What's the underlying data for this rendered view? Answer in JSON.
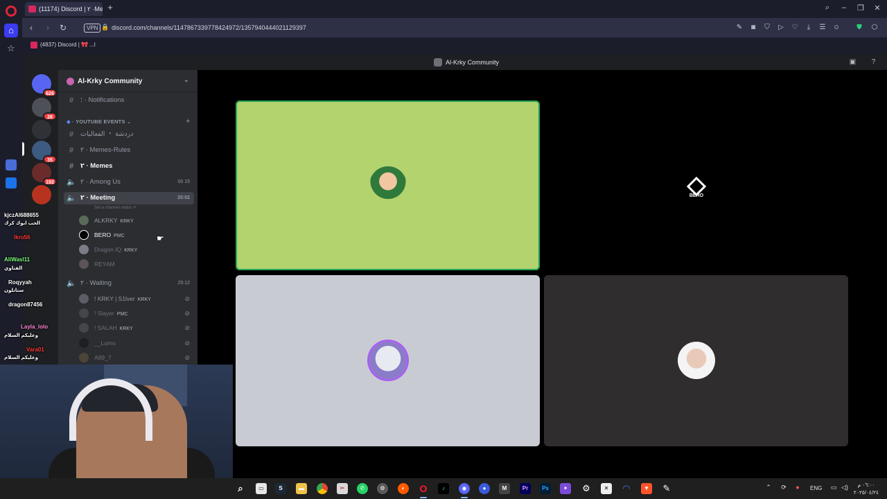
{
  "browser": {
    "tab_title": "(11174) Discord | ٢ ·Meeti...",
    "url": "discord.com/channels/1147867339778424972/1357940444021129397",
    "vpn_label": "VPN",
    "bookmark_label": "(4837) Discord | 🎀 ...l"
  },
  "discord": {
    "window_title": "Al-Krky Community",
    "server_name": "Al-Krky Community",
    "guilds": [
      {
        "badge": "626"
      },
      {
        "badge": "28"
      },
      {
        "badge": ""
      },
      {
        "badge": "35"
      },
      {
        "badge": "192"
      },
      {
        "badge": ""
      }
    ],
    "channels": {
      "notifications": "؛ · Notifications",
      "category_youtube": "YOUTUBE EVENTS",
      "arabic_channel": "دردشة ・ الفعاليات",
      "memes_rules": "٢ · Memes-Rules",
      "memes": "٢ · Memes",
      "among_us": "٢ · Among Us",
      "among_us_meta": "00   15",
      "meeting": "٢ · Meeting",
      "meeting_meta": "25:02",
      "meeting_status": "Set a channel status ✐",
      "waiting": "٢ · Waiting",
      "waiting_meta": "25:12"
    },
    "meeting_users": [
      {
        "name": "ALKRKY",
        "tag": "KRKY"
      },
      {
        "name": "BERO",
        "tag": "PMC"
      },
      {
        "name": "Dragon IQ",
        "tag": "KRKY"
      },
      {
        "name": "REYAM",
        "tag": ""
      }
    ],
    "waiting_users": [
      {
        "name": "! KRKY | S1lver",
        "tag": "KRKY"
      },
      {
        "name": "! Slayer",
        "tag": "PMC"
      },
      {
        "name": "! SALAH",
        "tag": "KRKY"
      },
      {
        "name": "__Lumo",
        "tag": ""
      },
      {
        "name": "A99_7",
        "tag": ""
      }
    ],
    "tiles": {
      "bero_label": "BERO"
    }
  },
  "stream_chat": [
    {
      "user": "kjczAl688655",
      "color": "#ffffff",
      "msg": "الحب ابوك كرك"
    },
    {
      "user": "lkro56",
      "color": "#ff3b3b",
      "msg": ""
    },
    {
      "user": "AliWasl11",
      "color": "#7cff7c",
      "msg": "الفتاوي"
    },
    {
      "user": "Roqyyah",
      "color": "#ffffff",
      "msg": "ستاتلون"
    },
    {
      "user": "dragon87456",
      "color": "#ffffff",
      "msg": ""
    },
    {
      "user": "Layla_lolo",
      "color": "#ff8ad8",
      "msg": "وعليكم السلام"
    },
    {
      "user": "Vara01",
      "color": "#ff3b3b",
      "msg": "وعليكم السلام"
    }
  ],
  "taskbar": {
    "lang": "ENG",
    "time": "٠٦:٠٠ م",
    "date": "٢٠٢٥/٠٤/٢٤"
  },
  "colors": {
    "tile_green": "#b3d36f",
    "tile_light": "#c9cbd3",
    "tile_dark": "#302d2f",
    "tile_black": "#000000",
    "speaking_ring": "#23a559",
    "discord_sidebar": "#2b2d31",
    "guild_bar": "#1e1f22"
  }
}
